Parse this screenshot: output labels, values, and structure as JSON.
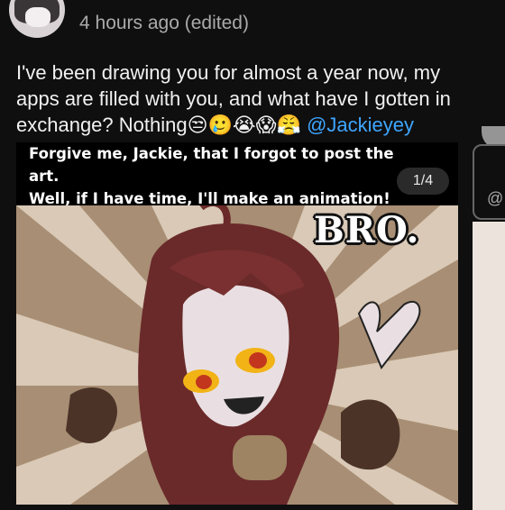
{
  "post": {
    "username": "",
    "timestamp": "4 hours ago (edited)",
    "text_main": "I've been drawing you for almost a year now, my apps are filled with you, and what have I gotten in exchange? Nothing",
    "emojis": "😒🥲😭😱😤",
    "mention": "@Jackieyey"
  },
  "carousel": {
    "caption_line1": "Forgive me, Jackie, that I forgot to post the art.",
    "caption_line2": "Well, if I have time, I'll make an animation!",
    "counter": "1/4",
    "art_text": "BRO."
  },
  "side_card": {
    "at_symbol": "@"
  },
  "colors": {
    "background": "#0f0f0f",
    "mention": "#3ea6ff",
    "timestamp": "#aaaaaa"
  }
}
